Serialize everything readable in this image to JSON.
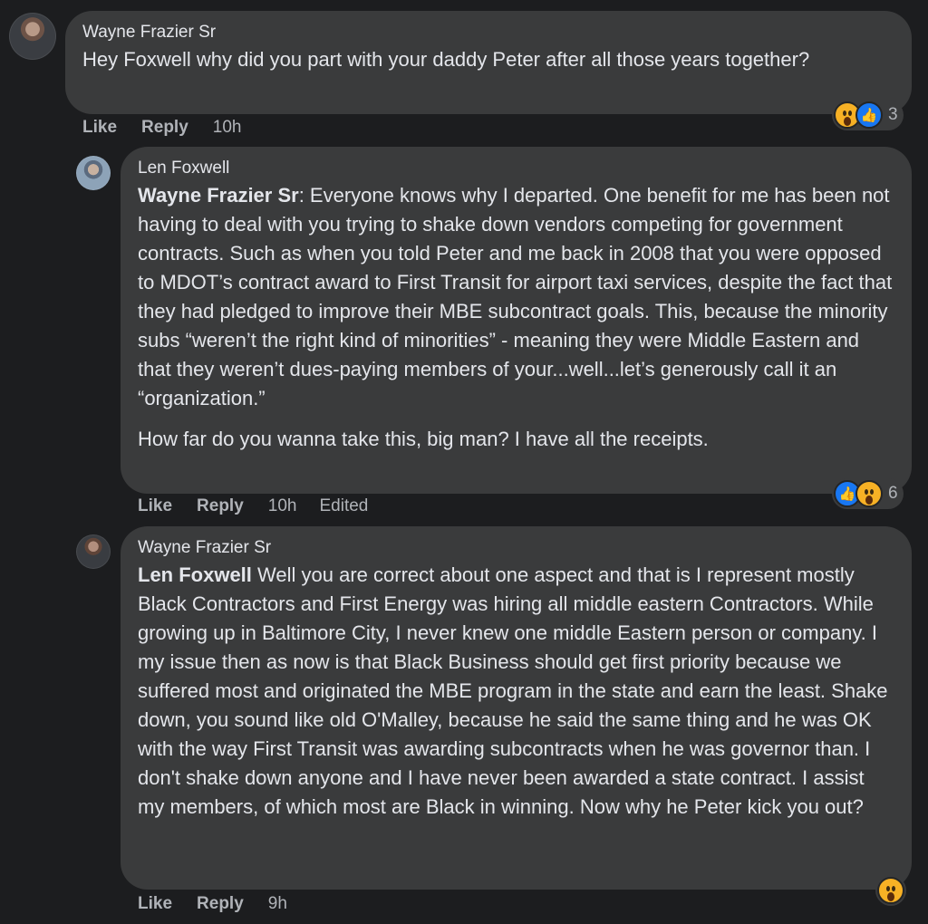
{
  "comments": [
    {
      "author": "Wayne Frazier Sr",
      "text": "Hey Foxwell why did you part with your daddy Peter after all those years together?",
      "actions": {
        "like": "Like",
        "reply": "Reply",
        "time": "10h"
      },
      "reactions": {
        "icons": [
          "wow-icon",
          "like-icon"
        ],
        "count": "3"
      }
    },
    {
      "author": "Len Foxwell",
      "mention": "Wayne Frazier Sr",
      "text": ": Everyone knows why I departed. One benefit for me has been not having to deal with you trying to shake down vendors competing for government contracts. Such as when you told Peter and me back in 2008 that you were opposed to MDOT’s contract award to First Transit for airport taxi services, despite the fact that they had pledged to improve their MBE subcontract goals. This, because the minority subs “weren’t the right kind of minorities” - meaning they were Middle Eastern and that they weren’t dues-paying members of your...well...let’s generously call it an “organization.”",
      "text2": "How far do you wanna take this, big man? I have all the receipts.",
      "actions": {
        "like": "Like",
        "reply": "Reply",
        "time": "10h",
        "edited": "Edited"
      },
      "reactions": {
        "icons": [
          "like-icon",
          "wow-icon"
        ],
        "count": "6"
      }
    },
    {
      "author": "Wayne Frazier Sr",
      "mention": "Len Foxwell",
      "text": " Well you are correct about one aspect and that is I represent mostly Black Contractors and First Energy was hiring all middle eastern Contractors. While growing up in Baltimore City, I never knew one middle Eastern person or company. I my issue then as now is that Black Business should get first priority because we suffered most and originated the MBE program in the state and earn the least. Shake down, you sound like old O'Malley, because he said the same thing and he was OK with the way First Transit was awarding subcontracts when he was governor than. I don't shake down anyone and I have never been awarded a state contract. I assist my members, of which most are Black in winning. Now why he Peter kick you out?",
      "actions": {
        "like": "Like",
        "reply": "Reply",
        "time": "9h"
      },
      "reactions": {
        "icons": [
          "wow-icon"
        ],
        "count": ""
      }
    }
  ],
  "colors": {
    "background": "#1c1d1f",
    "bubble": "#3a3b3c",
    "text": "#e4e6eb",
    "muted": "#b0b3b8",
    "like_blue": "#1877f2",
    "wow_yellow": "#f7b125"
  }
}
